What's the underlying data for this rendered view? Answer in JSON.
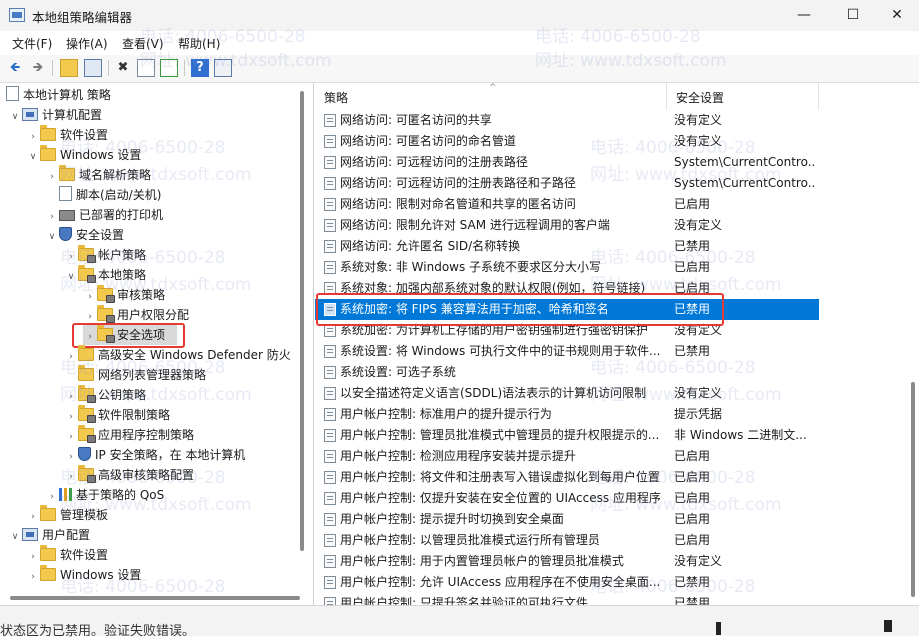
{
  "window": {
    "title": "本地组策略编辑器",
    "minimize": "—",
    "maximize": "☐",
    "close": "✕"
  },
  "menu": [
    "文件(F)",
    "操作(A)",
    "查看(V)",
    "帮助(H)"
  ],
  "toolbar": {
    "back": "🡸",
    "forward": "🡺",
    "delete": "✖",
    "help": "?"
  },
  "tree": [
    {
      "label": "本地计算机 策略",
      "icon": "doc-icon",
      "chevron": ""
    },
    {
      "label": "计算机配置",
      "icon": "computer-icon",
      "chevron": "∨"
    },
    {
      "label": "软件设置",
      "icon": "folder-icon",
      "chevron": "›"
    },
    {
      "label": "Windows 设置",
      "icon": "folder-icon",
      "chevron": "∨"
    },
    {
      "label": "域名解析策略",
      "icon": "folder-icon",
      "chevron": "›"
    },
    {
      "label": "脚本(启动/关机)",
      "icon": "doc-icon",
      "chevron": ""
    },
    {
      "label": "已部署的打印机",
      "icon": "printer-icon",
      "chevron": "›"
    },
    {
      "label": "安全设置",
      "icon": "shield-icon",
      "chevron": "∨"
    },
    {
      "label": "帐户策略",
      "icon": "folder-lock-icon",
      "chevron": "›"
    },
    {
      "label": "本地策略",
      "icon": "folder-lock-icon",
      "chevron": "∨"
    },
    {
      "label": "审核策略",
      "icon": "folder-lock-icon",
      "chevron": "›"
    },
    {
      "label": "用户权限分配",
      "icon": "folder-lock-icon",
      "chevron": "›"
    },
    {
      "label": "安全选项",
      "icon": "folder-lock-icon",
      "chevron": "›"
    },
    {
      "label": "高级安全 Windows Defender 防火",
      "icon": "folder-icon",
      "chevron": "›"
    },
    {
      "label": "网络列表管理器策略",
      "icon": "folder-icon",
      "chevron": ""
    },
    {
      "label": "公钥策略",
      "icon": "folder-lock-icon",
      "chevron": "›"
    },
    {
      "label": "软件限制策略",
      "icon": "folder-lock-icon",
      "chevron": "›"
    },
    {
      "label": "应用程序控制策略",
      "icon": "folder-lock-icon",
      "chevron": "›"
    },
    {
      "label": "IP 安全策略，在 本地计算机",
      "icon": "shield-icon",
      "chevron": "›"
    },
    {
      "label": "高级审核策略配置",
      "icon": "folder-lock-icon",
      "chevron": "›"
    },
    {
      "label": "基于策略的 QoS",
      "icon": "chart-icon",
      "chevron": "›"
    },
    {
      "label": "管理模板",
      "icon": "folder-icon",
      "chevron": "›"
    },
    {
      "label": "用户配置",
      "icon": "computer-icon",
      "chevron": "∨"
    },
    {
      "label": "软件设置",
      "icon": "folder-icon",
      "chevron": "›"
    },
    {
      "label": "Windows 设置",
      "icon": "folder-icon",
      "chevron": "›"
    }
  ],
  "columns": {
    "policy": "策略",
    "setting": "安全设置"
  },
  "policies": [
    {
      "name": "网络访问: 可匿名访问的共享",
      "value": "没有定义"
    },
    {
      "name": "网络访问: 可匿名访问的命名管道",
      "value": "没有定义"
    },
    {
      "name": "网络访问: 可远程访问的注册表路径",
      "value": "System\\CurrentContro..."
    },
    {
      "name": "网络访问: 可远程访问的注册表路径和子路径",
      "value": "System\\CurrentContro..."
    },
    {
      "name": "网络访问: 限制对命名管道和共享的匿名访问",
      "value": "已启用"
    },
    {
      "name": "网络访问: 限制允许对 SAM 进行远程调用的客户端",
      "value": "没有定义"
    },
    {
      "name": "网络访问: 允许匿名 SID/名称转换",
      "value": "已禁用"
    },
    {
      "name": "系统对象: 非 Windows 子系统不要求区分大小写",
      "value": "已启用"
    },
    {
      "name": "系统对象: 加强内部系统对象的默认权限(例如，符号链接)",
      "value": "已启用"
    },
    {
      "name": "系统加密: 将 FIPS 兼容算法用于加密、哈希和签名",
      "value": "已禁用"
    },
    {
      "name": "系统加密: 为计算机上存储的用户密钥强制进行强密钥保护",
      "value": "没有定义"
    },
    {
      "name": "系统设置: 将 Windows 可执行文件中的证书规则用于软件...",
      "value": "已禁用"
    },
    {
      "name": "系统设置: 可选子系统",
      "value": ""
    },
    {
      "name": "以安全描述符定义语言(SDDL)语法表示的计算机访问限制",
      "value": "没有定义"
    },
    {
      "name": "用户帐户控制: 标准用户的提升提示行为",
      "value": "提示凭据"
    },
    {
      "name": "用户帐户控制: 管理员批准模式中管理员的提升权限提示的...",
      "value": "非 Windows 二进制文..."
    },
    {
      "name": "用户帐户控制: 检测应用程序安装并提示提升",
      "value": "已启用"
    },
    {
      "name": "用户帐户控制: 将文件和注册表写入错误虚拟化到每用户位置",
      "value": "已启用"
    },
    {
      "name": "用户帐户控制: 仅提升安装在安全位置的 UIAccess 应用程序",
      "value": "已启用"
    },
    {
      "name": "用户帐户控制: 提示提升时切换到安全桌面",
      "value": "已启用"
    },
    {
      "name": "用户帐户控制: 以管理员批准模式运行所有管理员",
      "value": "已启用"
    },
    {
      "name": "用户帐户控制: 用于内置管理员帐户的管理员批准模式",
      "value": "没有定义"
    },
    {
      "name": "用户帐户控制: 允许 UIAccess 应用程序在不使用安全桌面...",
      "value": "已禁用"
    },
    {
      "name": "用户帐户控制: 只提升签名并验证的可执行文件",
      "value": "已禁用"
    }
  ],
  "status": "状态区为已禁用。验证失败错误。",
  "watermarks": {
    "phone": "电话: 4006-6500-28",
    "site": "网址: www.tdxsoft.com"
  }
}
